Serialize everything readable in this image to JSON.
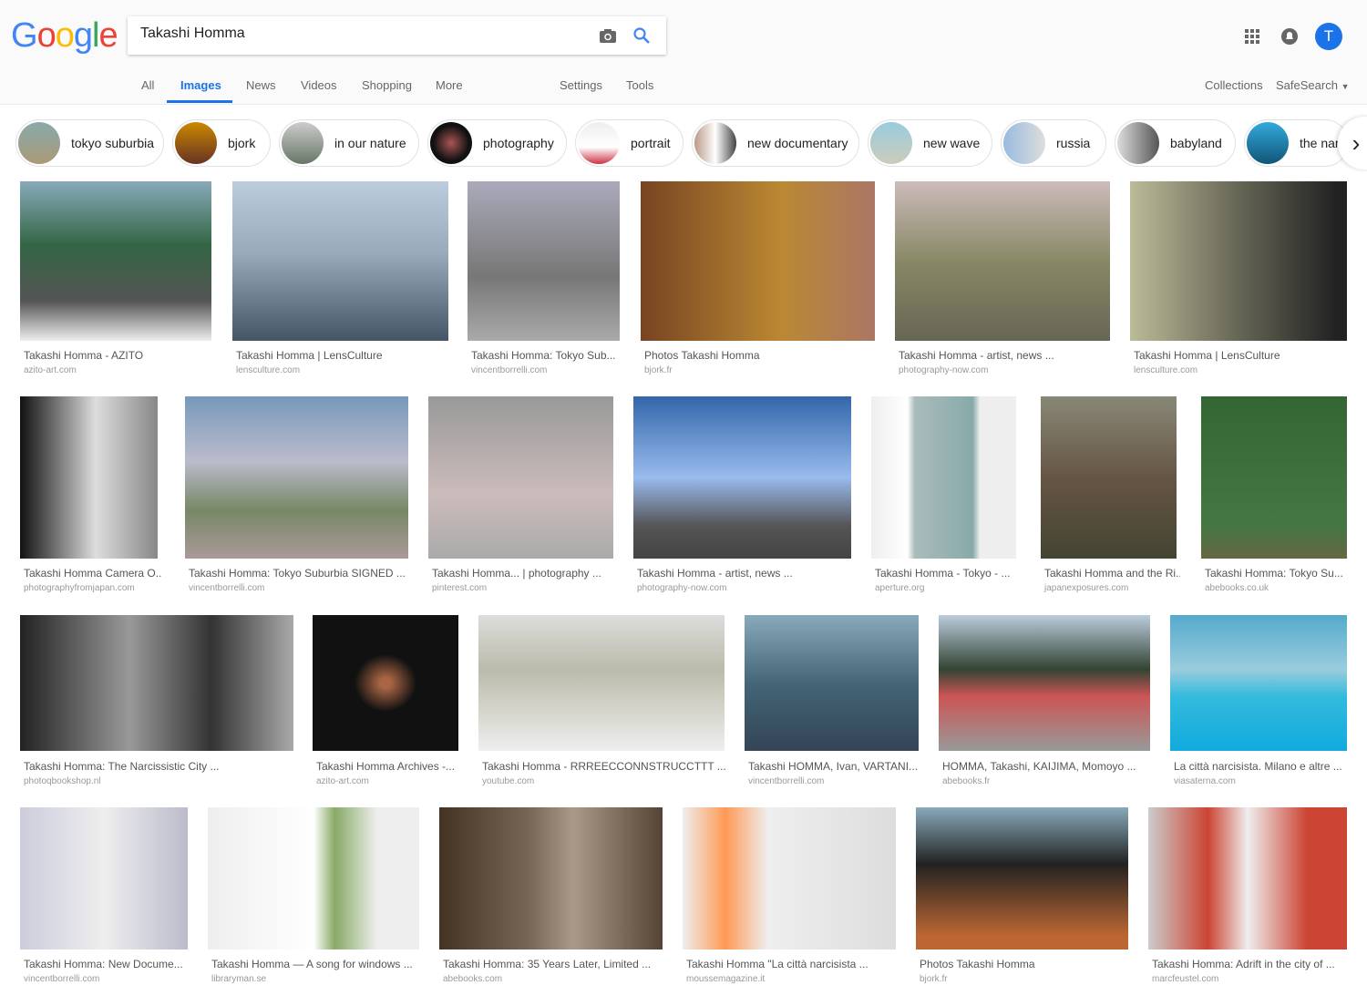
{
  "header": {
    "logo": "Google",
    "query": "Takashi Homma",
    "avatar_letter": "T",
    "icons": [
      "camera-icon",
      "search-icon",
      "apps-grid-icon",
      "notifications-icon"
    ]
  },
  "nav": {
    "tabs": [
      {
        "label": "All"
      },
      {
        "label": "Images",
        "active": true
      },
      {
        "label": "News"
      },
      {
        "label": "Videos"
      },
      {
        "label": "Shopping"
      },
      {
        "label": "More"
      },
      {
        "label": "Settings"
      },
      {
        "label": "Tools"
      }
    ],
    "collections": "Collections",
    "safesearch": "SafeSearch"
  },
  "chips": [
    {
      "label": "tokyo suburbia"
    },
    {
      "label": "bjork"
    },
    {
      "label": "in our nature"
    },
    {
      "label": "photography"
    },
    {
      "label": "portrait"
    },
    {
      "label": "new documentary"
    },
    {
      "label": "new wave"
    },
    {
      "label": "russia"
    },
    {
      "label": "babyland"
    },
    {
      "label": "the nar"
    }
  ],
  "colors": {
    "accent": "#1a73e8",
    "avatar": "#1a73e8"
  },
  "results": [
    {
      "title": "Takashi Homma - AZITO",
      "domain": "azito-art.com"
    },
    {
      "title": "Takashi Homma | LensCulture",
      "domain": "lensculture.com"
    },
    {
      "title": "Takashi Homma: Tokyo Sub...",
      "domain": "vincentborrelli.com"
    },
    {
      "title": "Photos Takashi Homma",
      "domain": "bjork.fr"
    },
    {
      "title": "Takashi Homma - artist, news ...",
      "domain": "photography-now.com"
    },
    {
      "title": "Takashi Homma | LensCulture",
      "domain": "lensculture.com"
    },
    {
      "title": "Takashi Homma Camera O...",
      "domain": "photographyfromjapan.com"
    },
    {
      "title": "Takashi Homma: Tokyo Suburbia SIGNED ...",
      "domain": "vincentborrelli.com"
    },
    {
      "title": "Takashi Homma... | photography ...",
      "domain": "pinterest.com"
    },
    {
      "title": "Takashi Homma - artist, news ...",
      "domain": "photography-now.com"
    },
    {
      "title": "Takashi Homma - Tokyo - ...",
      "domain": "aperture.org"
    },
    {
      "title": "Takashi Homma and the Ri...",
      "domain": "japanexposures.com"
    },
    {
      "title": "Takashi Homma: Tokyo Su...",
      "domain": "abebooks.co.uk"
    },
    {
      "title": "Takashi Homma: The Narcissistic City ...",
      "domain": "photoqbookshop.nl"
    },
    {
      "title": "Takashi Homma Archives -...",
      "domain": "azito-art.com"
    },
    {
      "title": "Takashi Homma - RRREECCONNSTRUCCTTT ...",
      "domain": "youtube.com"
    },
    {
      "title": "Takashi HOMMA, Ivan, VARTANI...",
      "domain": "vincentborrelli.com"
    },
    {
      "title": "HOMMA, Takashi, KAIJIMA, Momoyo ...",
      "domain": "abebooks.fr"
    },
    {
      "title": "La città narcisista. Milano e altre ...",
      "domain": "viasaterna.com"
    },
    {
      "title": "Takashi Homma: New Docume...",
      "domain": "vincentborrelli.com"
    },
    {
      "title": "Takashi Homma — A song for windows ...",
      "domain": "libraryman.se"
    },
    {
      "title": "Takashi Homma: 35 Years Later, Limited ...",
      "domain": "abebooks.com"
    },
    {
      "title": "Takashi Homma \"La città narcisista ...",
      "domain": "moussemagazine.it"
    },
    {
      "title": "Photos Takashi Homma",
      "domain": "bjork.fr"
    },
    {
      "title": "Takashi Homma: Adrift in the city of ...",
      "domain": "marcfeustel.com"
    }
  ]
}
